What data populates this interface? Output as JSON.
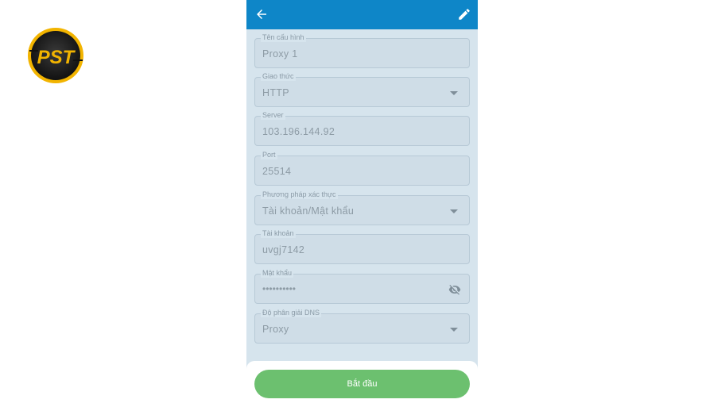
{
  "logo": {
    "text": "PST"
  },
  "appbar": {
    "back_icon": "arrow-left-icon",
    "edit_icon": "pencil-icon",
    "color": "#0e86c8"
  },
  "form": {
    "config_name": {
      "label": "Tên cấu hình",
      "value": "Proxy 1"
    },
    "protocol": {
      "label": "Giao thức",
      "value": "HTTP"
    },
    "server": {
      "label": "Server",
      "value": "103.196.144.92"
    },
    "port": {
      "label": "Port",
      "value": "25514"
    },
    "auth_method": {
      "label": "Phương pháp xác thực",
      "value": "Tài khoản/Mật khẩu"
    },
    "account": {
      "label": "Tài khoản",
      "value": "uvgj7142"
    },
    "password": {
      "label": "Mật khẩu",
      "value": "••••••••••",
      "visibility_icon": "eye-off-icon"
    },
    "dns": {
      "label": "Độ phân giải DNS",
      "value": "Proxy"
    }
  },
  "actions": {
    "start_label": "Bắt đầu",
    "start_color": "#6cc06f"
  }
}
